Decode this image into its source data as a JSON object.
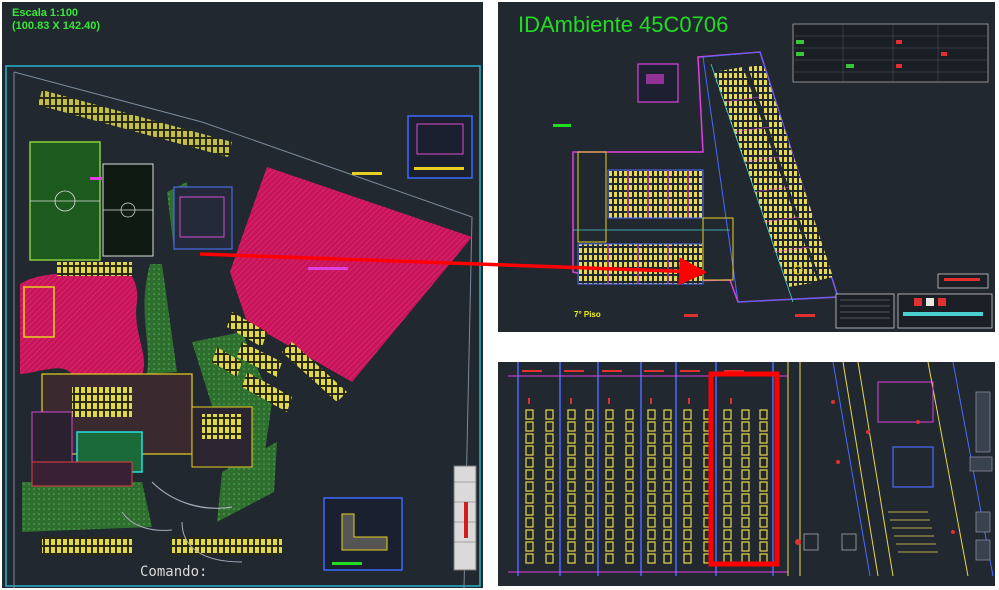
{
  "left_view": {
    "scale_title": "Escala 1:100",
    "scale_dims": "(100.83 X 142.40)",
    "command_prompt": "Comando:"
  },
  "top_right_view": {
    "room_id": "IDAmbiente 45C0706",
    "floor_label": "7° Piso"
  },
  "colors": {
    "cad_background": "#212830",
    "hatch_magenta": "#c8145a",
    "grass_green": "#2f7a2f",
    "callout_arrow": "#ff0000",
    "highlight_box": "#ff0000",
    "label_green": "#22dd22"
  }
}
